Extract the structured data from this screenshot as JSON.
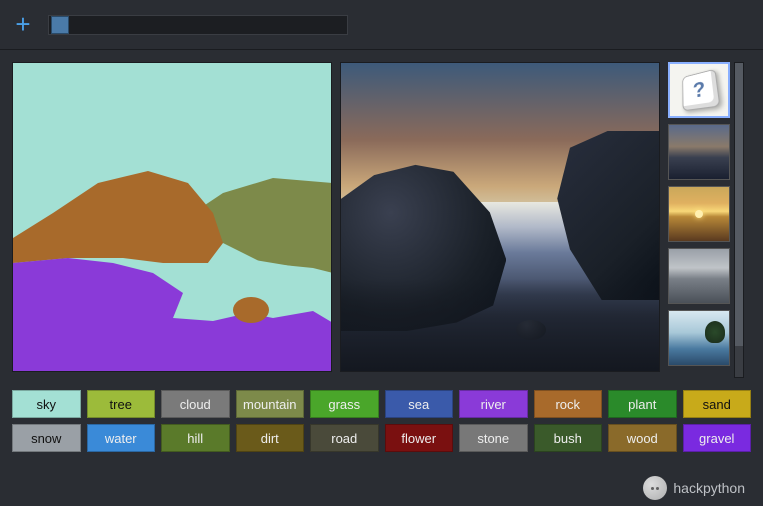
{
  "toolbar": {
    "plus_label": "+"
  },
  "styles": {
    "items": [
      {
        "name": "random-dice"
      },
      {
        "name": "dusk-sea"
      },
      {
        "name": "sunset-ocean"
      },
      {
        "name": "storm-clouds"
      },
      {
        "name": "lake-tree"
      }
    ]
  },
  "palette": {
    "row1": [
      {
        "label": "sky",
        "color": "#a3e0d4"
      },
      {
        "label": "tree",
        "color": "#9cbb3a"
      },
      {
        "label": "cloud",
        "color": "#7a7a7a"
      },
      {
        "label": "mountain",
        "color": "#7d8a4a"
      },
      {
        "label": "grass",
        "color": "#4aa62a"
      },
      {
        "label": "sea",
        "color": "#3a5aaa"
      },
      {
        "label": "river",
        "color": "#8a3ad8"
      },
      {
        "label": "rock",
        "color": "#a86a2b"
      },
      {
        "label": "plant",
        "color": "#2a8a2a"
      },
      {
        "label": "sand",
        "color": "#c8aa1a"
      }
    ],
    "row2": [
      {
        "label": "snow",
        "color": "#9aa0a6"
      },
      {
        "label": "water",
        "color": "#3a8ad8"
      },
      {
        "label": "hill",
        "color": "#5a7a2a"
      },
      {
        "label": "dirt",
        "color": "#6a5a1a"
      },
      {
        "label": "road",
        "color": "#4a4a3a"
      },
      {
        "label": "flower",
        "color": "#7a1010"
      },
      {
        "label": "stone",
        "color": "#787878"
      },
      {
        "label": "bush",
        "color": "#3a5a2a"
      },
      {
        "label": "wood",
        "color": "#8a6a2a"
      },
      {
        "label": "gravel",
        "color": "#7a2ae0"
      }
    ]
  },
  "watermark": {
    "text": "hackpython"
  }
}
